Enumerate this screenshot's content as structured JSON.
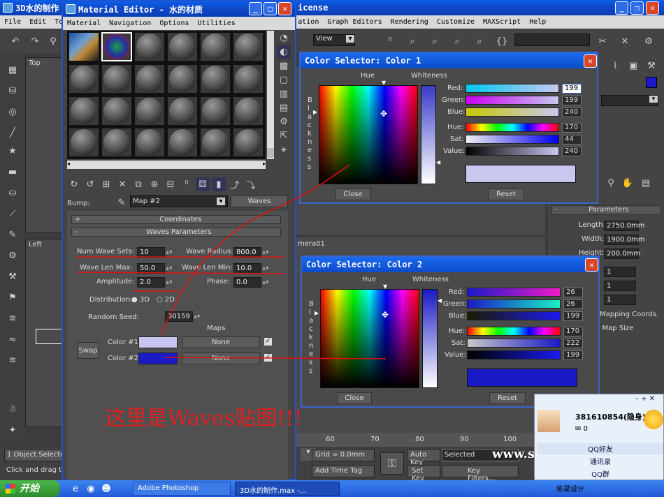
{
  "main_window": {
    "title": "3D水的制作",
    "title_right": "icense",
    "menu_left": [
      "File",
      "Edit",
      "Too"
    ],
    "menu_right": [
      "ation",
      "Graph Editors",
      "Rendering",
      "Customize",
      "MAXScript",
      "Help"
    ],
    "view_dropdown": "View",
    "viewport_top": "Top",
    "viewport_left": "Left",
    "camera_label": "mera01"
  },
  "material_editor": {
    "title": "Material Editor - 水的材质",
    "menu": [
      "Material",
      "Navigation",
      "Options",
      "Utilities"
    ],
    "bump_label": "Bump:",
    "map_name": "Map #2",
    "map_type": "Waves",
    "rollout_coordinates": "Coordinates",
    "rollout_waves": "Waves Parameters",
    "num_wave_sets_label": "Num Wave Sets:",
    "num_wave_sets": "10",
    "wave_radius_label": "Wave Radius:",
    "wave_radius": "800.0",
    "wave_len_max_label": "Wave Len Max:",
    "wave_len_max": "50.0",
    "wave_len_min_label": "Wave Len Min:",
    "wave_len_min": "10.0",
    "amplitude_label": "Amplitude:",
    "amplitude": "2.0",
    "phase_label": "Phase:",
    "phase": "0.0",
    "distribution_label": "Distribution:",
    "dist_3d": "3D",
    "dist_2d": "2D",
    "random_seed_label": "Random Seed:",
    "random_seed": "30159",
    "maps_header": "Maps",
    "swap_label": "Swap",
    "color1_label": "Color #1",
    "color2_label": "Color #2",
    "map1": "None",
    "map2": "None",
    "color1": "#c6c6f0",
    "color2": "#1a1ac7"
  },
  "color_selector_1": {
    "title": "Color Selector: Color 1",
    "hue_label": "Hue",
    "whiteness_label": "Whiteness",
    "blackness_label": "Blackness",
    "red_label": "Red:",
    "red": "199",
    "green_label": "Green:",
    "green": "199",
    "blue_label": "Blue:",
    "blue": "240",
    "hue2_label": "Hue:",
    "hue": "170",
    "sat_label": "Sat:",
    "sat": "44",
    "value_label": "Value:",
    "value": "240",
    "close": "Close",
    "reset": "Reset",
    "swatch": "#c7c7f0"
  },
  "color_selector_2": {
    "title": "Color Selector: Color 2",
    "hue_label": "Hue",
    "whiteness_label": "Whiteness",
    "blackness_label": "Blackness",
    "red_label": "Red:",
    "red": "26",
    "green_label": "Green:",
    "green": "26",
    "blue_label": "Blue:",
    "blue": "199",
    "hue2_label": "Hue:",
    "hue": "170",
    "sat_label": "Sat:",
    "sat": "222",
    "value_label": "Value:",
    "value": "199",
    "close": "Close",
    "reset": "Reset",
    "swatch": "#1a1ac7"
  },
  "command_panel": {
    "parameters": "Parameters",
    "length_label": "Length:",
    "length": "2750.0mm",
    "width_label": "Width:",
    "width": "1900.0mm",
    "height_label": "Height:",
    "height": "200.0mm",
    "seg1": "1",
    "seg2": "1",
    "seg3": "1",
    "mapping": "Mapping Coords.",
    "mapsize": "d Map Size"
  },
  "status": {
    "selected": "1 Object Selecte",
    "hint": "Click and drag to",
    "grid": "Grid = 0.0mm",
    "add_time_tag": "Add Time Tag",
    "auto_key": "Auto Key",
    "set_key": "Set Key",
    "selected_mode": "Selected",
    "key_filters": "Key Filters...",
    "timeline": [
      "60",
      "70",
      "80",
      "90",
      "100"
    ]
  },
  "annotation": "这里是Waves贴图!!!",
  "watermark": "www.snren.com",
  "qq": {
    "id": "381610854(隐身)",
    "mail": "0",
    "group1": "QQ好友",
    "group2": "通讯录",
    "group3": "QQ群",
    "group4": "栋梁设计"
  },
  "taskbar": {
    "start": "开始",
    "task1": "Adobe Photoshop",
    "task2": "3D水的制作.max -..."
  }
}
